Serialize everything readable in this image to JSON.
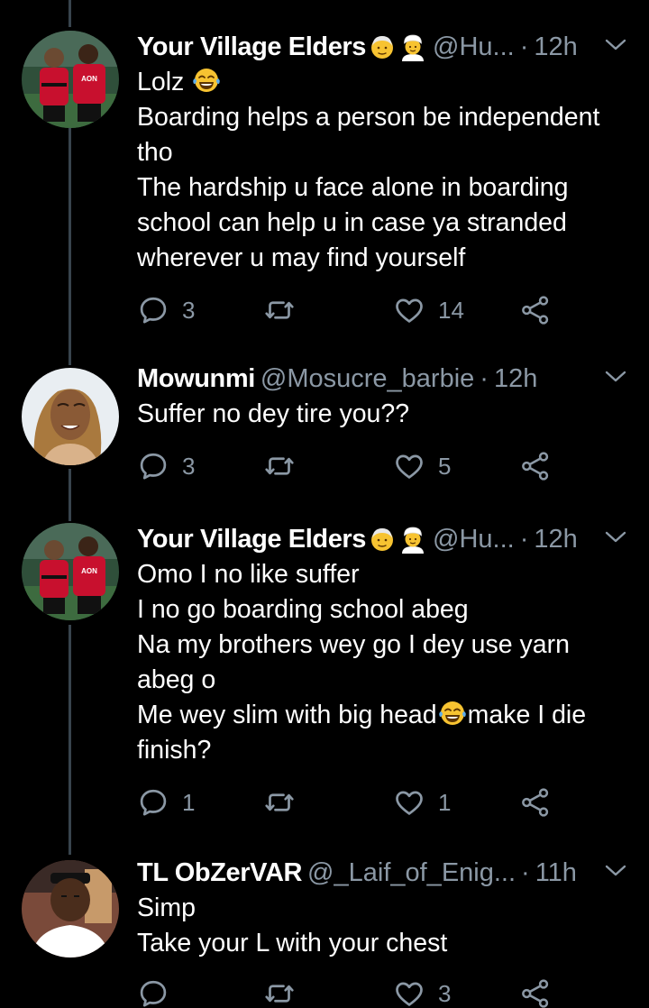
{
  "tweets": [
    {
      "name": "Your Village Elders",
      "badges": [
        "older-person-emoji",
        "man-with-turban-emoji"
      ],
      "handle": "@Hu...",
      "dot": "·",
      "time": "12h",
      "lines": [
        "Lolz",
        "Boarding helps a person be independent",
        "tho",
        "The hardship u face alone in boarding",
        "school can help u in case ya stranded",
        "wherever u may find yourself"
      ],
      "replies": "3",
      "retweets": "",
      "likes": "14"
    },
    {
      "name": "Mowunmi",
      "handle": "@Mosucre_barbie",
      "dot": "·",
      "time": "12h",
      "lines": [
        "Suffer no dey tire you??"
      ],
      "replies": "3",
      "retweets": "",
      "likes": "5"
    },
    {
      "name": "Your Village Elders",
      "badges": [
        "older-person-emoji",
        "man-with-turban-emoji"
      ],
      "handle": "@Hu...",
      "dot": "·",
      "time": "12h",
      "lines": [
        "Omo I no like suffer",
        "I no go boarding school abeg",
        "Na my brothers wey go I dey use yarn",
        "abeg o",
        "Me wey slim with big head",
        "make I die",
        "finish?"
      ],
      "replies": "1",
      "retweets": "",
      "likes": "1"
    },
    {
      "name": "TL ObZerVAR",
      "handle": "@_Laif_of_Enig...",
      "dot": "·",
      "time": "11h",
      "lines": [
        "Simp",
        "Take your L with your chest"
      ],
      "replies": "",
      "retweets": "",
      "likes": "3"
    }
  ],
  "icons": {
    "reply": "reply-icon",
    "retweet": "retweet-icon",
    "like": "heart-icon",
    "share": "share-icon",
    "caret": "chevron-down-icon",
    "laugh": "face-with-tears-of-joy-emoji"
  },
  "colors": {
    "background": "#000000",
    "text": "#ffffff",
    "secondary": "#8b98a5",
    "thread_line": "#38444d",
    "emoji_yellow": "#f7c331"
  }
}
